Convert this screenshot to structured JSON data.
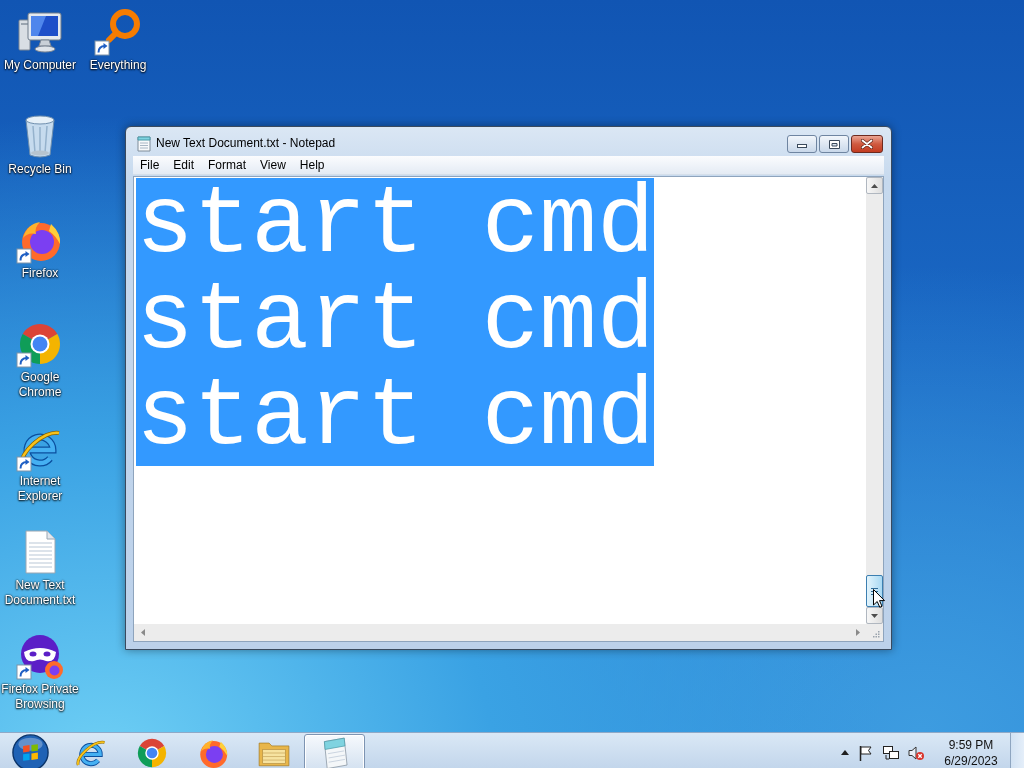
{
  "desktop": {
    "icon_columns": [
      {
        "icons": [
          {
            "label": "My Computer",
            "kind": "computer",
            "shortcut": false
          },
          {
            "label": "Recycle Bin",
            "kind": "recycle-bin",
            "shortcut": false
          },
          {
            "label": "Firefox",
            "kind": "firefox",
            "shortcut": true
          },
          {
            "label": "Google Chrome",
            "kind": "chrome",
            "shortcut": true
          },
          {
            "label": "Internet Explorer",
            "kind": "ie",
            "shortcut": true
          },
          {
            "label": "New Text Document.txt",
            "kind": "text-file",
            "shortcut": false
          },
          {
            "label": "Firefox Private Browsing",
            "kind": "private",
            "shortcut": true
          }
        ]
      },
      {
        "icons": [
          {
            "label": "Everything",
            "kind": "search-ring",
            "shortcut": true
          }
        ]
      }
    ]
  },
  "window": {
    "title": "New Text Document.txt - Notepad",
    "menu": [
      "File",
      "Edit",
      "Format",
      "View",
      "Help"
    ],
    "editor": {
      "lines": [
        "start cmd",
        "start cmd",
        "start cmd"
      ],
      "selected": true
    }
  },
  "taskbar": {
    "pinned": [
      {
        "kind": "ie",
        "selected": false
      },
      {
        "kind": "chrome",
        "selected": false
      },
      {
        "kind": "firefox",
        "selected": false
      },
      {
        "kind": "explorer",
        "selected": false
      },
      {
        "kind": "notepad",
        "selected": true
      }
    ],
    "tray": {
      "volume_muted": true,
      "time": "9:59 PM",
      "date": "6/29/2023"
    }
  }
}
